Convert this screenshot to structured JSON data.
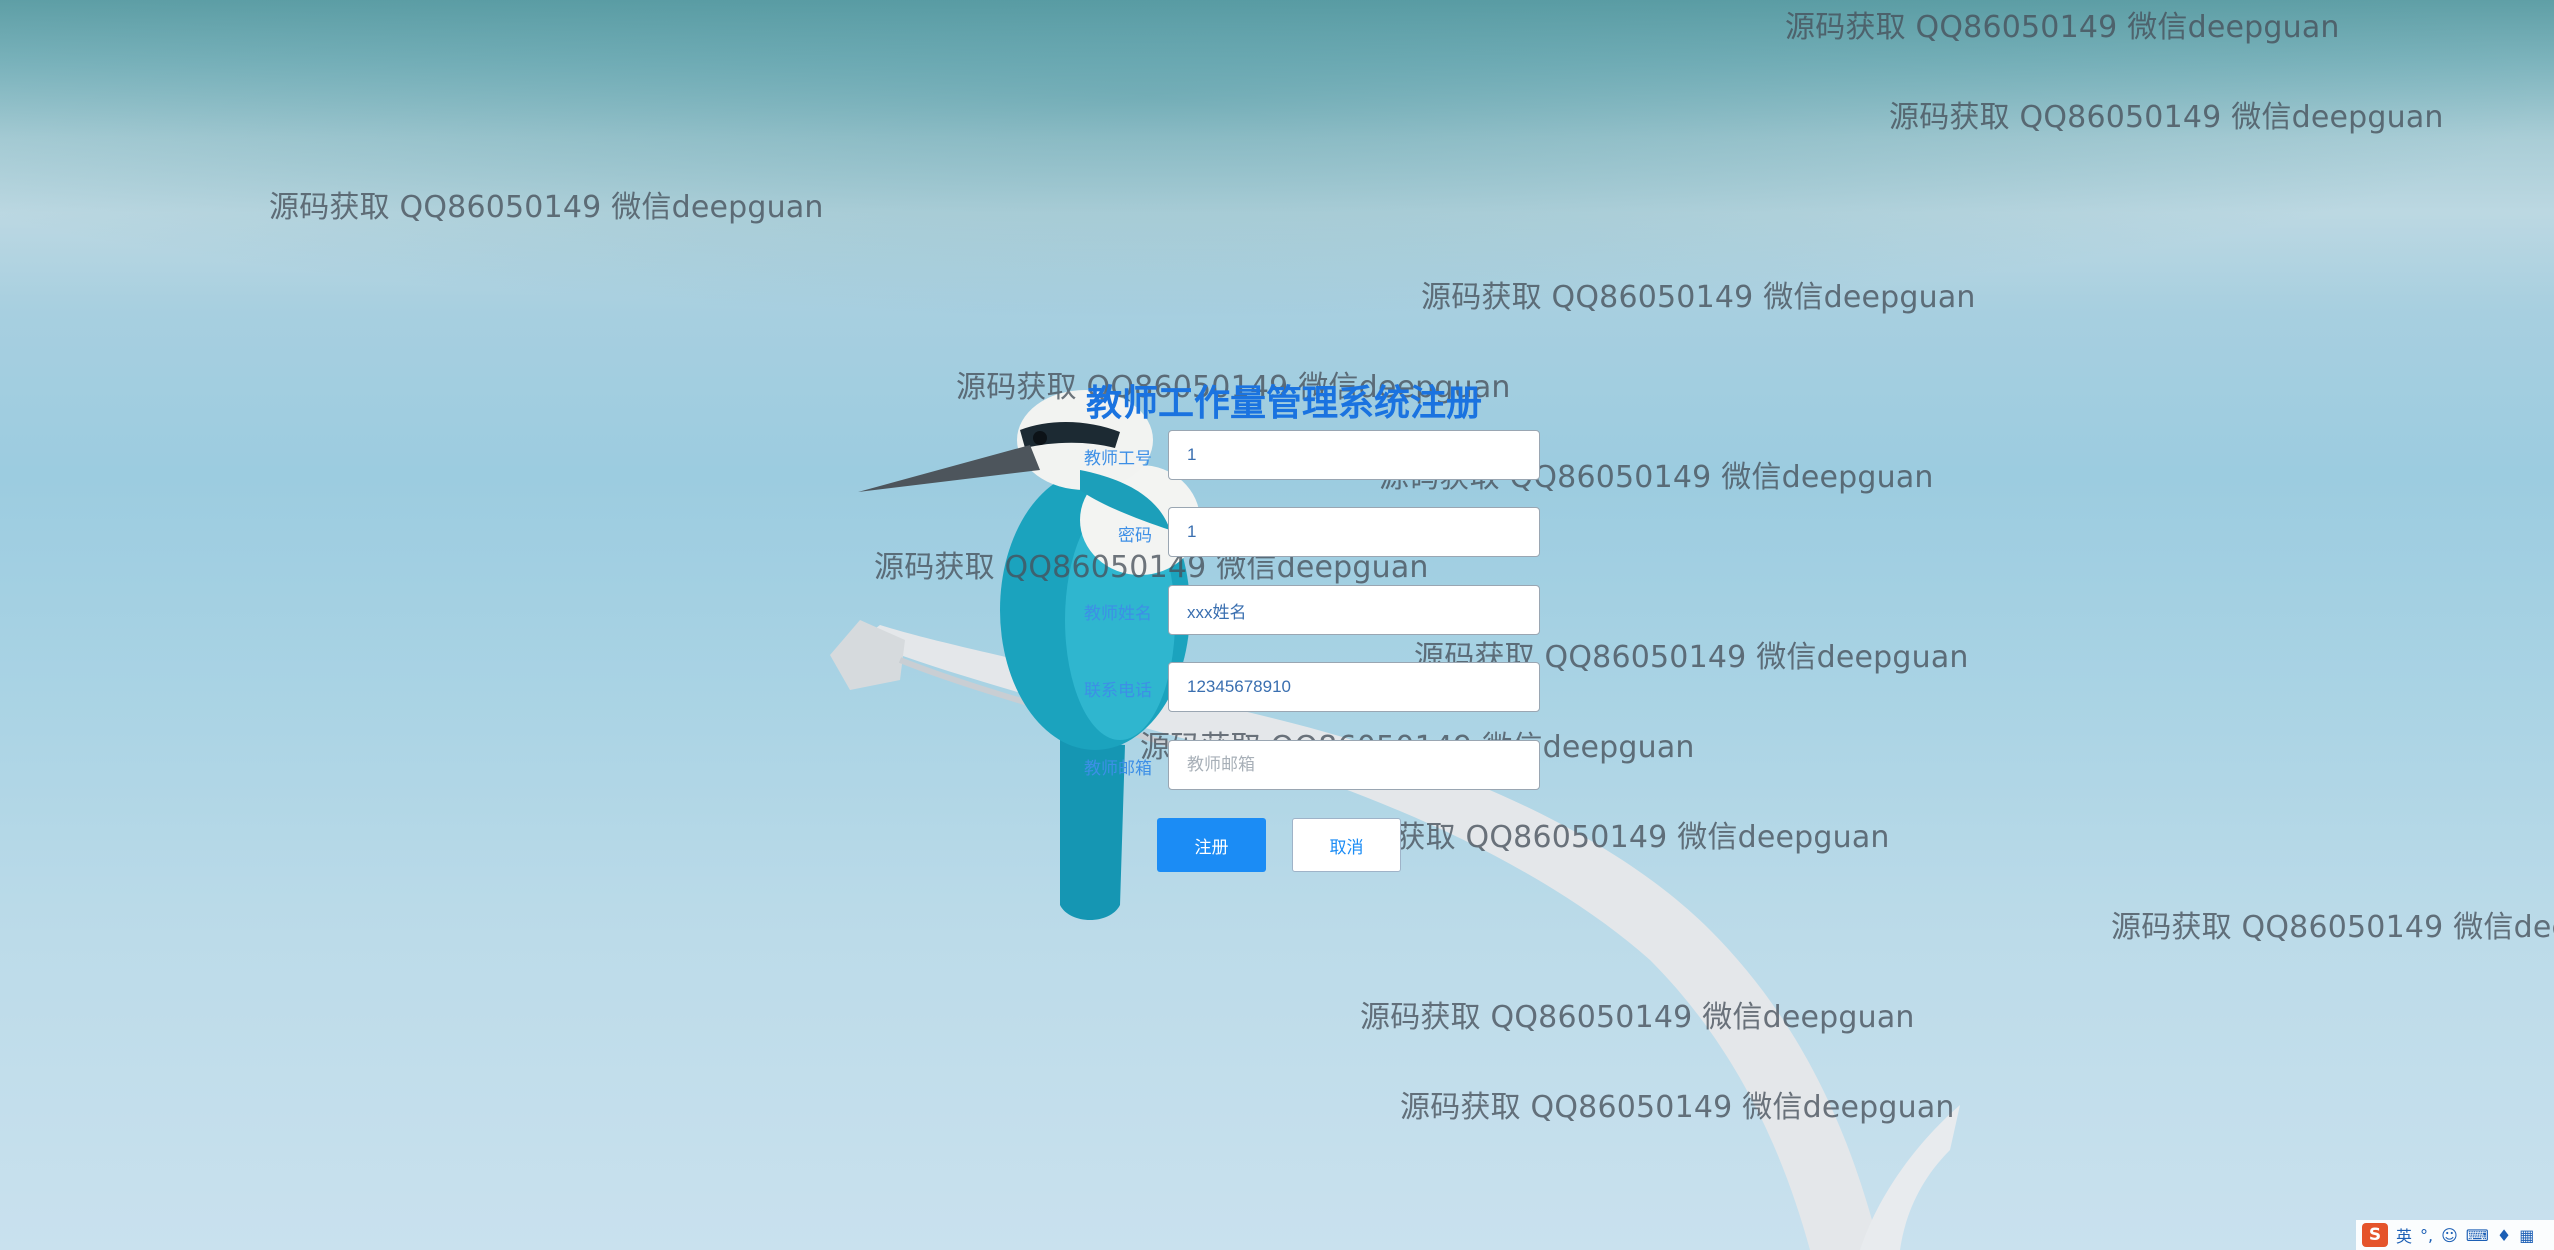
{
  "page": {
    "form_title": "教师工作量管理系统注册"
  },
  "form": {
    "fields": [
      {
        "label": "教师工号",
        "value": "1",
        "placeholder": ""
      },
      {
        "label": "密码",
        "value": "1",
        "placeholder": ""
      },
      {
        "label": "教师姓名",
        "value": "xxx姓名",
        "placeholder": ""
      },
      {
        "label": "联系电话",
        "value": "12345678910",
        "placeholder": ""
      },
      {
        "label": "教师邮箱",
        "value": "",
        "placeholder": "教师邮箱"
      }
    ],
    "register_label": "注册",
    "cancel_label": "取消"
  },
  "watermark_text": "源码获取 QQ86050149 微信deepguan",
  "watermark_clipped_text": "源码获取 QQ86050149 微信dee",
  "ime_toolbar": {
    "logo": "S",
    "lang": "英",
    "icons": [
      "punctuation-icon",
      "emoji-icon",
      "keyboard-icon",
      "skin-icon",
      "grid-icon"
    ]
  },
  "colors": {
    "accent": "#1b8cf5",
    "title": "#1a73e0",
    "label": "#3d8fe6",
    "watermark": "#46505a"
  }
}
